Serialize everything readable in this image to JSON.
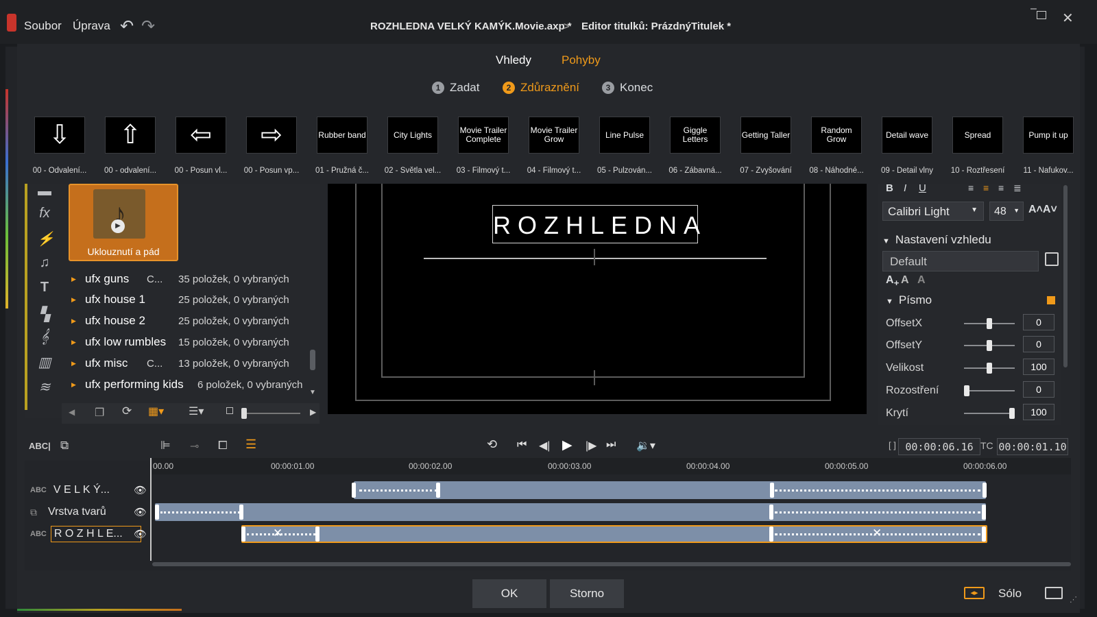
{
  "menu": {
    "file": "Soubor",
    "edit": "Úprava"
  },
  "breadcrumb": {
    "project": "ROZHLEDNA VELKÝ KAMÝK.Movie.axp *",
    "separator": ">",
    "editor": "Editor titulků: PrázdnýTitulek *"
  },
  "modes": {
    "looks": "Vhledy",
    "motions": "Pohyby"
  },
  "steps": [
    {
      "num": "1",
      "label": "Zadat"
    },
    {
      "num": "2",
      "label": "Zdůraznění"
    },
    {
      "num": "3",
      "label": "Konec"
    }
  ],
  "motions": [
    {
      "preview": "⇩",
      "caption": "00 - Odvalení..."
    },
    {
      "preview": "⇧",
      "caption": "00 - odvalení..."
    },
    {
      "preview": "⇦",
      "caption": "00 - Posun vl..."
    },
    {
      "preview": "⇨",
      "caption": "00 - Posun vp..."
    },
    {
      "preview": "Rubber band",
      "caption": "01 - Pružná č..."
    },
    {
      "preview": "City Lights",
      "caption": "02 - Světla vel..."
    },
    {
      "preview": "Movie Trailer Complete",
      "caption": "03 - Filmový t..."
    },
    {
      "preview": "Movie Trailer Grow",
      "caption": "04 - Filmový t..."
    },
    {
      "preview": "Line Pulse",
      "caption": "05 - Pulzován..."
    },
    {
      "preview": "Giggle Letters",
      "caption": "06 - Zábavná..."
    },
    {
      "preview": "Getting Taller",
      "caption": "07 - Zvyšování"
    },
    {
      "preview": "Random Grow",
      "caption": "08 - Náhodné..."
    },
    {
      "preview": "Detail wave",
      "caption": "09 - Detail vlny"
    },
    {
      "preview": "Spread",
      "caption": "10 - Roztřesení"
    },
    {
      "preview": "Pump it up",
      "caption": "11 - Nafukov..."
    }
  ],
  "media": {
    "title": "Uklouznutí a pád"
  },
  "library": [
    {
      "name": "ufx guns",
      "abbr": "C...",
      "count": "35 položek, 0 vybraných"
    },
    {
      "name": "ufx house 1",
      "abbr": "",
      "count": "25 položek, 0 vybraných"
    },
    {
      "name": "ufx house 2",
      "abbr": "",
      "count": "25 položek, 0 vybraných"
    },
    {
      "name": "ufx low rumbles",
      "abbr": "",
      "count": "15 položek, 0 vybraných"
    },
    {
      "name": "ufx misc",
      "abbr": "C...",
      "count": "13 položek, 0 vybraných"
    },
    {
      "name": "ufx performing kids",
      "abbr": "",
      "count": "6 položek, 0 vybraných"
    }
  ],
  "preview": {
    "title_text": "ROZHLEDNA"
  },
  "font": {
    "family": "Calibri Light",
    "size": "48"
  },
  "appearance": {
    "section": "Nastavení vzhledu",
    "preset": "Default",
    "font_section": "Písmo"
  },
  "properties": [
    {
      "label": "OffsetX",
      "value": "0",
      "level": 0.5
    },
    {
      "label": "OffsetY",
      "value": "0",
      "level": 0.5
    },
    {
      "label": "Velikost",
      "value": "100",
      "level": 0.5
    },
    {
      "label": "Rozostření",
      "value": "0",
      "level": 0.0
    },
    {
      "label": "Krytí",
      "value": "100",
      "level": 1.0
    }
  ],
  "timecode": {
    "duration": "00:00:06.16",
    "tc_label": "TC",
    "current": "00:00:01.10"
  },
  "ruler": [
    "00.00",
    "00:00:01.00",
    "00:00:02.00",
    "00:00:03.00",
    "00:00:04.00",
    "00:00:05.00",
    "00:00:06.00"
  ],
  "tracks": [
    {
      "name": "V E L K Ý...",
      "type": "ABC"
    },
    {
      "name": "Vrstva tvarů",
      "type": "shape"
    },
    {
      "name": "R O Z H L E...",
      "type": "ABC"
    }
  ],
  "buttons": {
    "ok": "OK",
    "cancel": "Storno",
    "solo": "Sólo"
  },
  "colors": {
    "accent": "#f09a1a",
    "clip": "#7d8fa8",
    "background": "#25272b"
  }
}
